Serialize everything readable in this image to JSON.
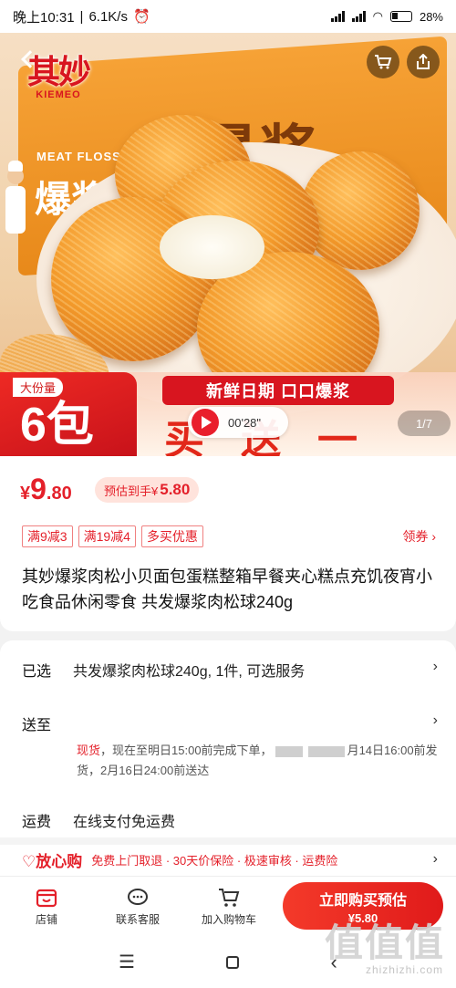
{
  "status_bar": {
    "time": "晚上10:31",
    "speed": "6.1K/s",
    "battery": "28%"
  },
  "hero": {
    "logo_cn": "其妙",
    "logo_en": "KIEMEO",
    "box_text_en": "MEAT FLOSS B",
    "box_text_cn": "爆浆",
    "box_big": "爆浆",
    "icons": [
      "back-icon",
      "cart-icon",
      "share-icon"
    ]
  },
  "promo": {
    "size_tag": "大份量",
    "count": "6包",
    "slogan": "新鲜日期  口口爆浆",
    "buy_give": "买送一",
    "video_time": "00'28\"",
    "counter": "1/7"
  },
  "price": {
    "currency": "¥",
    "integer": "9",
    "decimal": ".80",
    "estimate_label": "预估到手¥",
    "estimate_value": "5.80"
  },
  "coupons": [
    "满9减3",
    "满19减4",
    "多买优惠"
  ],
  "coupon_link": "领券 ›",
  "title": "其妙爆浆肉松小贝面包蛋糕整箱早餐夹心糕点充饥夜宵小吃食品休闲零食 共发爆浆肉松球240g",
  "spec": {
    "selected_label": "已选",
    "selected_value": "共发爆浆肉松球240g, 1件, 可选服务",
    "ship_label": "送至",
    "ship_prefix": "现货",
    "ship_text_a": "，现在至明日15:00前完成下单，",
    "ship_text_b": "月14日16:00前发货，2月16日24:00前送达",
    "fee_label": "运费",
    "fee_value": "在线支付免运费"
  },
  "assurance": {
    "brand": "♡放心购",
    "items": "免费上门取退 · 30天价保险 · 极速审核 · 运费险"
  },
  "bottom_bar": {
    "store": "店铺",
    "service": "联系客服",
    "cart": "加入购物车",
    "buy_line1": "立即购买预估",
    "buy_line2": "¥5.80"
  },
  "watermark": {
    "cn": "值值值",
    "en": "zhizhizhi.com"
  },
  "colors": {
    "accent_red": "#e4202a",
    "button_red": "#f43a2a"
  }
}
